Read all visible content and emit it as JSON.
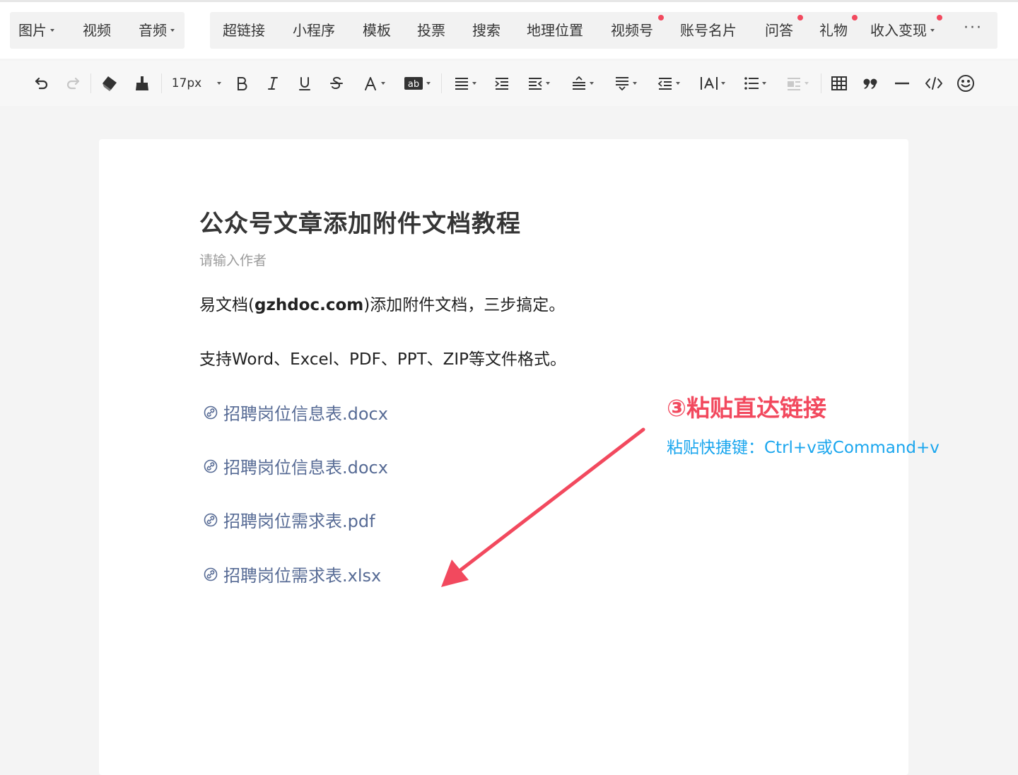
{
  "insert_toolbar": {
    "group_a": [
      {
        "label": "图片",
        "dropdown": true
      },
      {
        "label": "视频",
        "dropdown": false
      },
      {
        "label": "音频",
        "dropdown": true
      }
    ],
    "group_b": [
      {
        "label": "超链接",
        "dot": false,
        "dropdown": false
      },
      {
        "label": "小程序",
        "dot": false,
        "dropdown": false
      },
      {
        "label": "模板",
        "dot": false,
        "dropdown": false
      },
      {
        "label": "投票",
        "dot": false,
        "dropdown": false
      },
      {
        "label": "搜索",
        "dot": false,
        "dropdown": false
      },
      {
        "label": "地理位置",
        "dot": false,
        "dropdown": false
      },
      {
        "label": "视频号",
        "dot": true,
        "dropdown": false
      },
      {
        "label": "账号名片",
        "dot": false,
        "dropdown": false
      },
      {
        "label": "问答",
        "dot": true,
        "dropdown": false
      },
      {
        "label": "礼物",
        "dot": true,
        "dropdown": false
      },
      {
        "label": "收入变现",
        "dot": true,
        "dropdown": true
      }
    ],
    "more_label": "···",
    "dot_color": "#f2495e"
  },
  "format_toolbar": {
    "font_size": "17px",
    "tools": [
      "undo-icon",
      "redo-icon",
      "format-eraser-icon",
      "format-painter-icon",
      "font-size-select",
      "bold-icon",
      "italic-icon",
      "underline-icon",
      "strikethrough-icon",
      "font-color-icon",
      "background-color-icon",
      "align-icon",
      "indent-icon",
      "outdent-icon",
      "line-height-icon",
      "paragraph-spacing-icon",
      "letter-spacing-icon",
      "text-width-icon",
      "list-icon",
      "float-icon",
      "table-icon",
      "quote-icon",
      "divider-icon",
      "code-icon",
      "emoji-icon"
    ]
  },
  "document": {
    "title": "公众号文章添加附件文档教程",
    "author_placeholder": "请输入作者",
    "paragraph1_prefix": "易文档(",
    "paragraph1_bold": "gzhdoc.com",
    "paragraph1_suffix": ")添加附件文档，三步搞定。",
    "paragraph2": "支持Word、Excel、PDF、PPT、ZIP等文件格式。",
    "attachments": [
      "招聘岗位信息表.docx",
      "招聘岗位信息表.docx",
      "招聘岗位需求表.pdf",
      "招聘岗位需求表.xlsx"
    ],
    "link_color": "#576b95"
  },
  "annotation": {
    "title": "③粘贴直达链接",
    "subtitle": "粘贴快捷键：Ctrl+v或Command+v",
    "title_color": "#f2495e",
    "subtitle_color": "#1aa6ee"
  }
}
